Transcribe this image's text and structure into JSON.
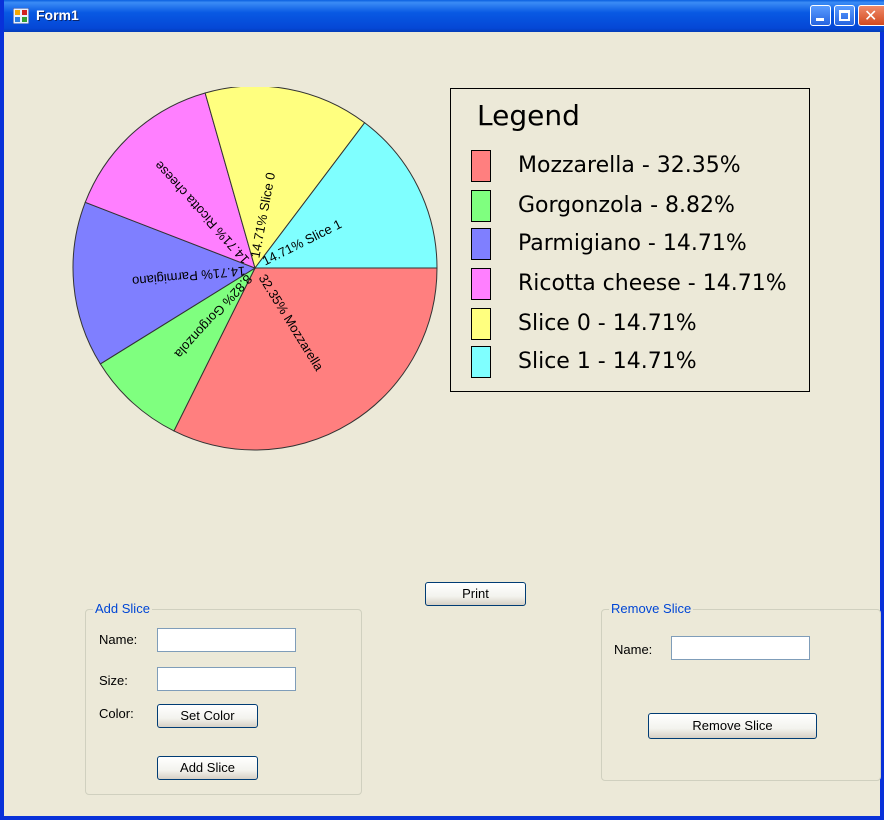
{
  "window": {
    "title": "Form1"
  },
  "title_buttons": {
    "minimize": "minimize-button",
    "maximize": "maximize-button",
    "close": "close-button"
  },
  "chart_data": {
    "type": "pie",
    "slices": [
      {
        "name": "Mozzarella",
        "percent": 32.35,
        "color": "#FF7F7F",
        "label": "32.35% Mozzarella"
      },
      {
        "name": "Gorgonzola",
        "percent": 8.82,
        "color": "#7FFF7F",
        "label": "8.82% Gorgonzola"
      },
      {
        "name": "Parmigiano",
        "percent": 14.71,
        "color": "#7F7FFF",
        "label": "14.71% Parmigiano"
      },
      {
        "name": "Ricotta cheese",
        "percent": 14.71,
        "color": "#FF7FFF",
        "label": "14.71% Ricotta cheese"
      },
      {
        "name": "Slice 0",
        "percent": 14.71,
        "color": "#FFFF7F",
        "label": "14.71% Slice 0"
      },
      {
        "name": "Slice 1",
        "percent": 14.71,
        "color": "#7FFFFF",
        "label": "14.71% Slice 1"
      }
    ],
    "legend_title": "Legend",
    "legend_entries": [
      "Mozzarella - 32.35%",
      "Gorgonzola - 8.82%",
      "Parmigiano - 14.71%",
      "Ricotta cheese - 14.71%",
      "Slice 0 - 14.71%",
      "Slice 1 - 14.71%"
    ],
    "legend_placement": "right"
  },
  "buttons": {
    "print": "Print"
  },
  "add_slice": {
    "group_title": "Add Slice",
    "name_label": "Name:",
    "name_value": "",
    "size_label": "Size:",
    "size_value": "",
    "color_label": "Color:",
    "set_color_button": "Set Color",
    "add_button": "Add Slice"
  },
  "remove_slice": {
    "group_title": "Remove Slice",
    "name_label": "Name:",
    "name_value": "",
    "remove_button": "Remove Slice"
  }
}
